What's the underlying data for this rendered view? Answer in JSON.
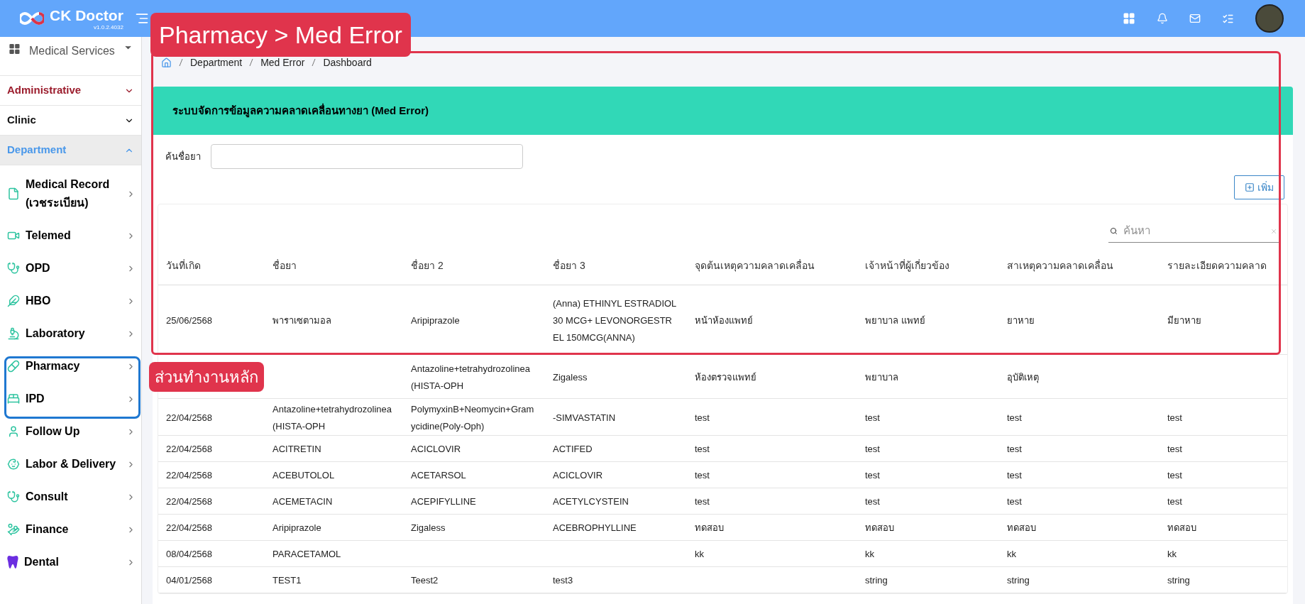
{
  "topbar": {
    "brand": "CK Doctor",
    "version": "v1.0.2.4032"
  },
  "sidebar": {
    "services_menu": "Medical Services",
    "sections": [
      {
        "label": "Administrative",
        "expanded": false,
        "selected": false,
        "color": "#9b1c2c"
      },
      {
        "label": "Clinic",
        "expanded": false,
        "selected": false,
        "color": "#111111"
      },
      {
        "label": "Department",
        "expanded": true,
        "selected": true,
        "color": "#4a98ea"
      }
    ],
    "items": [
      {
        "label": "Medical Record (เวชระเบียน)"
      },
      {
        "label": "Telemed"
      },
      {
        "label": "OPD"
      },
      {
        "label": "HBO"
      },
      {
        "label": "Laboratory"
      },
      {
        "label": "Pharmacy"
      },
      {
        "label": "IPD"
      },
      {
        "label": "Follow Up"
      },
      {
        "label": "Labor & Delivery"
      },
      {
        "label": "Consult"
      },
      {
        "label": "Finance"
      },
      {
        "label": "Dental"
      }
    ]
  },
  "breadcrumb": [
    "Department",
    "Med Error",
    "Dashboard"
  ],
  "card": {
    "title": "ระบบจัดการข้อมูลความคลาดเคลื่อนทางยา (Med Error)",
    "filter_label": "ค้นชื่อยา",
    "add_button": "เพิ่ม"
  },
  "table": {
    "search_placeholder": "ค้นหา",
    "columns": [
      "วันที่เกิด",
      "ชื่อยา",
      "ชื่อยา 2",
      "ชื่อยา 3",
      "จุดต้นเหตุความคลาดเคลื่อน",
      "เจ้าหน้าที่ผู้เกี่ยวข้อง",
      "สาเหตุความคลาดเคลื่อน",
      "รายละเอียดความคลาด"
    ],
    "rows": [
      [
        "25/06/2568",
        "พาราเซตามอล",
        "Aripiprazole",
        "(Anna) ETHINYL ESTRADIOL30 MCG+ LEVONORGESTREL 150MCG(ANNA)",
        "หน้าห้องแพทย์",
        "พยาบาล แพทย์",
        "ยาหาย",
        "มียาหาย"
      ],
      [
        null,
        null,
        "Antazoline+tetrahydrozolinea (HISTA-OPH",
        "Zigaless",
        "ห้องตรวจแพทย์",
        "พยาบาล",
        "อุบัติเหตุ",
        null
      ],
      [
        "22/04/2568",
        "Antazoline+tetrahydrozolinea (HISTA-OPH",
        "PolymyxinB+Neomycin+Gramycidine(Poly-Oph)",
        "-SIMVASTATIN",
        "test",
        "test",
        "test",
        "test"
      ],
      [
        "22/04/2568",
        "ACITRETIN",
        "ACICLOVIR",
        "ACTIFED",
        "test",
        "test",
        "test",
        "test"
      ],
      [
        "22/04/2568",
        "ACEBUTOLOL",
        "ACETARSOL",
        "ACICLOVIR",
        "test",
        "test",
        "test",
        "test"
      ],
      [
        "22/04/2568",
        "ACEMETACIN",
        "ACEPIFYLLINE",
        "ACETYLCYSTEIN",
        "test",
        "test",
        "test",
        "test"
      ],
      [
        "22/04/2568",
        "Aripiprazole",
        "Zigaless",
        "ACEBROPHYLLINE",
        "ทดสอบ",
        "ทดสอบ",
        "ทดสอบ",
        "ทดสอบ"
      ],
      [
        "08/04/2568",
        "PARACETAMOL",
        null,
        null,
        "kk",
        "kk",
        "kk",
        "kk"
      ],
      [
        "04/01/2568",
        "TEST1",
        "Teest2",
        "test3",
        null,
        "string",
        "string",
        "string"
      ]
    ]
  },
  "annotations": [
    {
      "kind": "label",
      "text": "Pharmacy > Med Error"
    },
    {
      "kind": "label",
      "text": "ส่วนทำงานหลัก"
    }
  ]
}
